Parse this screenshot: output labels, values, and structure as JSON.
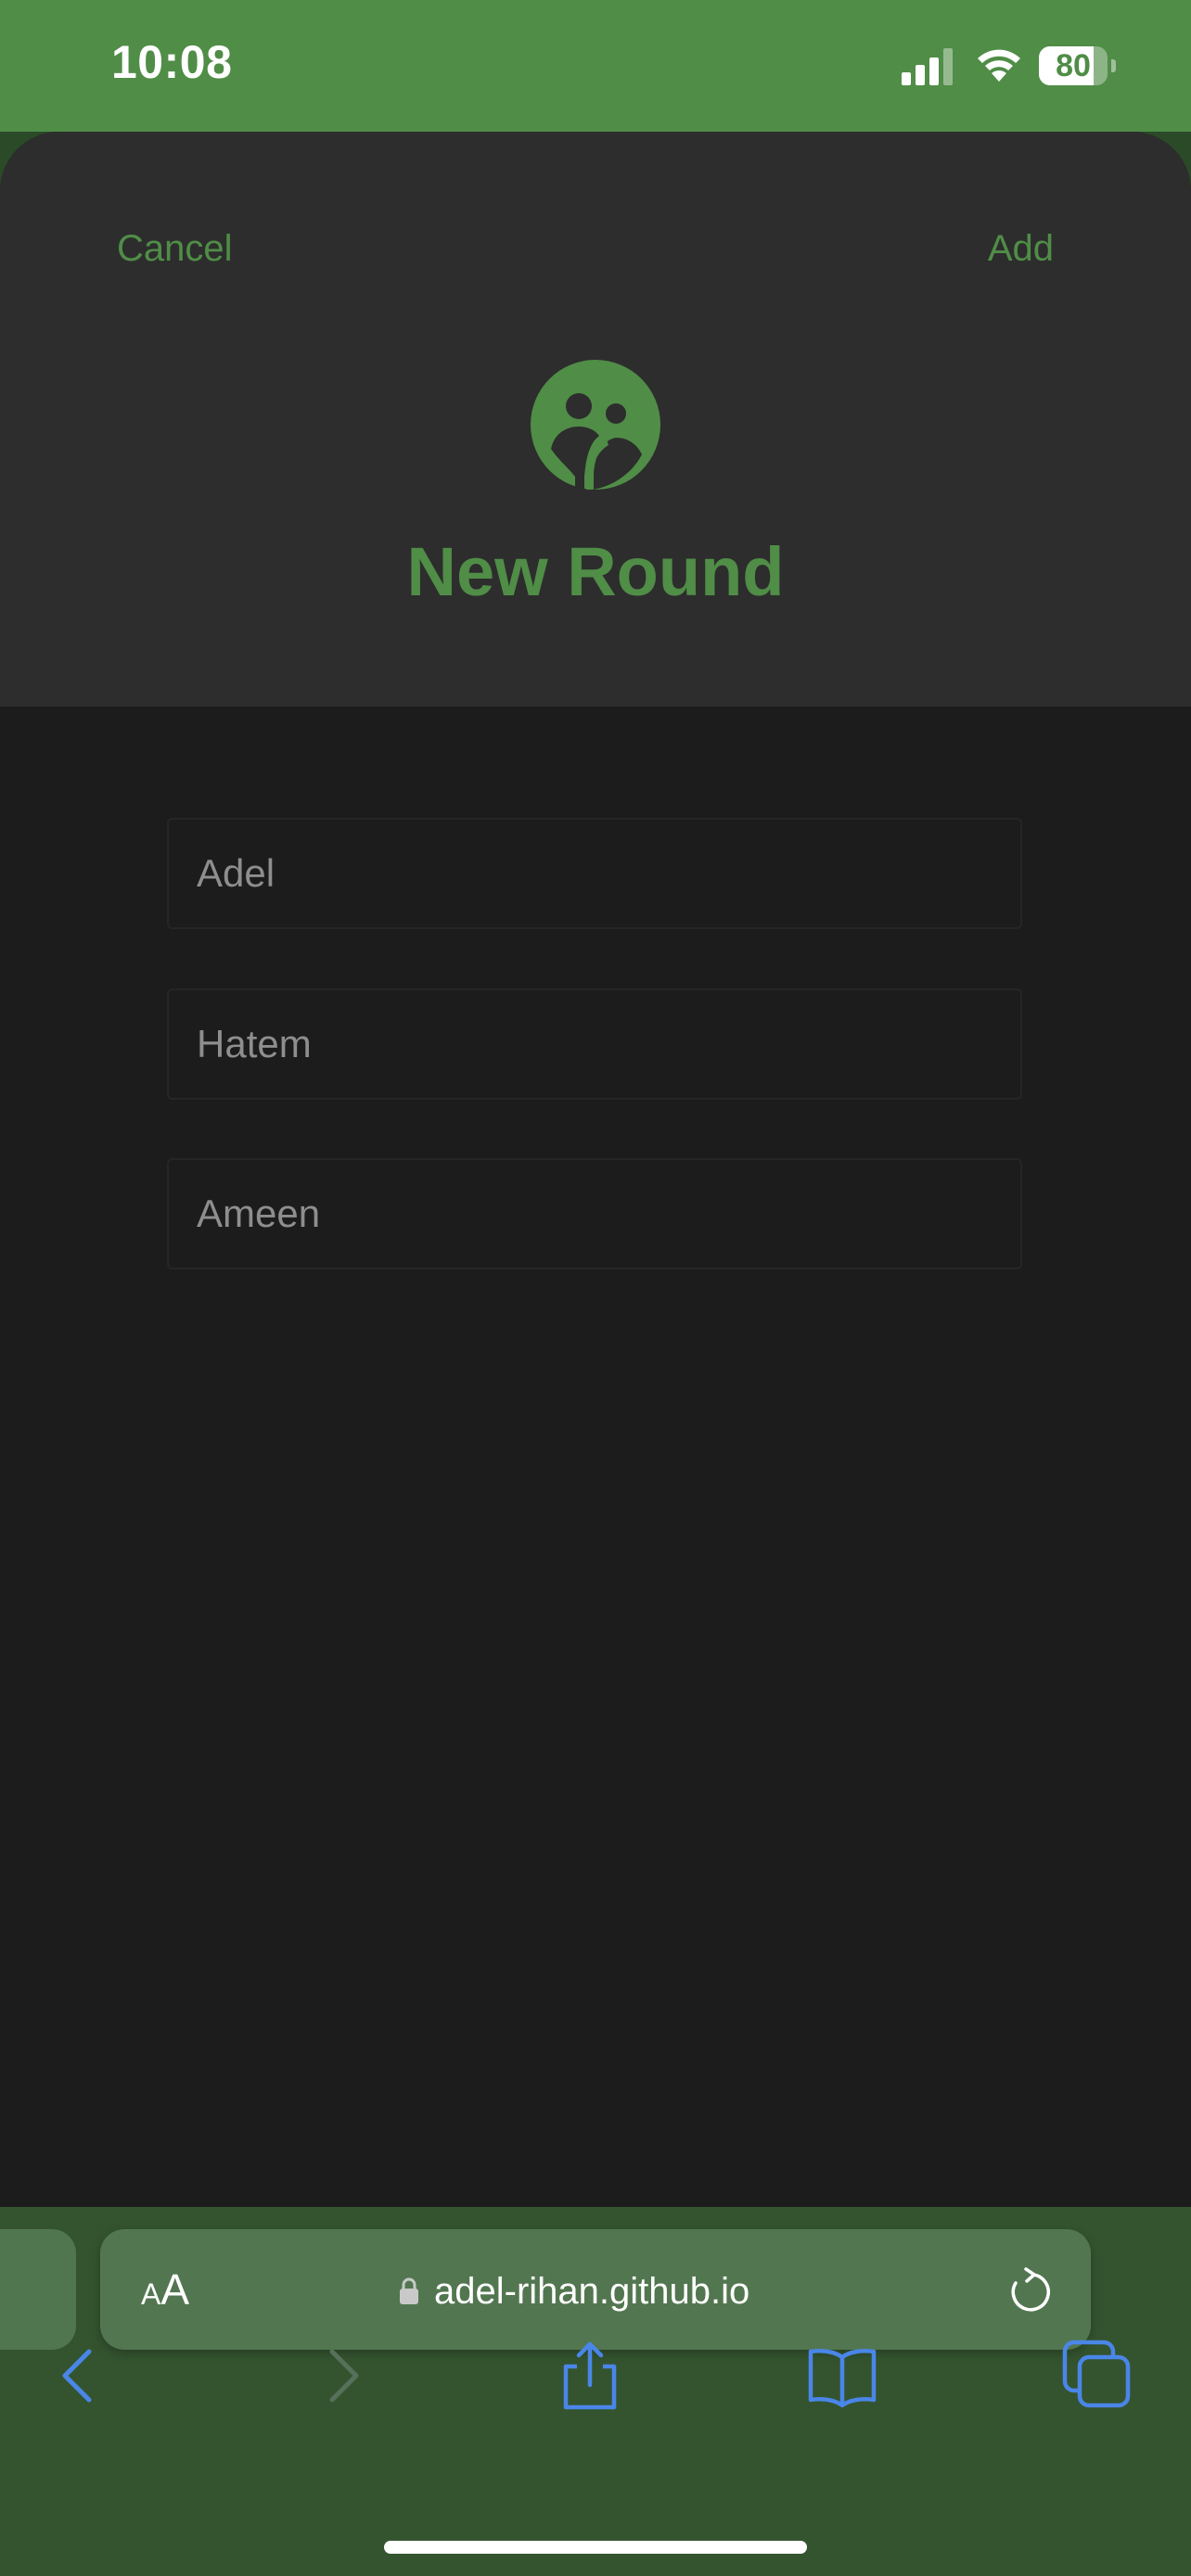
{
  "status_bar": {
    "time": "10:08",
    "battery_level": 80,
    "battery_label": "80",
    "icons": [
      "cellular-signal-icon",
      "wifi-icon",
      "battery-icon"
    ]
  },
  "sheet": {
    "cancel_label": "Cancel",
    "add_label": "Add",
    "header_icon": "people-icon",
    "title": "New Round",
    "players": [
      {
        "placeholder": "Adel"
      },
      {
        "placeholder": "Hatem"
      },
      {
        "placeholder": "Ameen"
      }
    ]
  },
  "browser": {
    "text_size_label_small": "A",
    "text_size_label_large": "A",
    "url": "adel-rihan.github.io",
    "icons": [
      "lock-icon",
      "reload-icon",
      "back-icon",
      "forward-icon",
      "share-icon",
      "bookmarks-icon",
      "tabs-icon"
    ]
  },
  "colors": {
    "accent_green": "#508d47",
    "sheet_header": "#2d2d2d",
    "sheet_body": "#1c1c1c",
    "browser_bar": "#34542f",
    "toolbar_icon": "#4a86e8",
    "disabled_icon": "#56705a"
  }
}
